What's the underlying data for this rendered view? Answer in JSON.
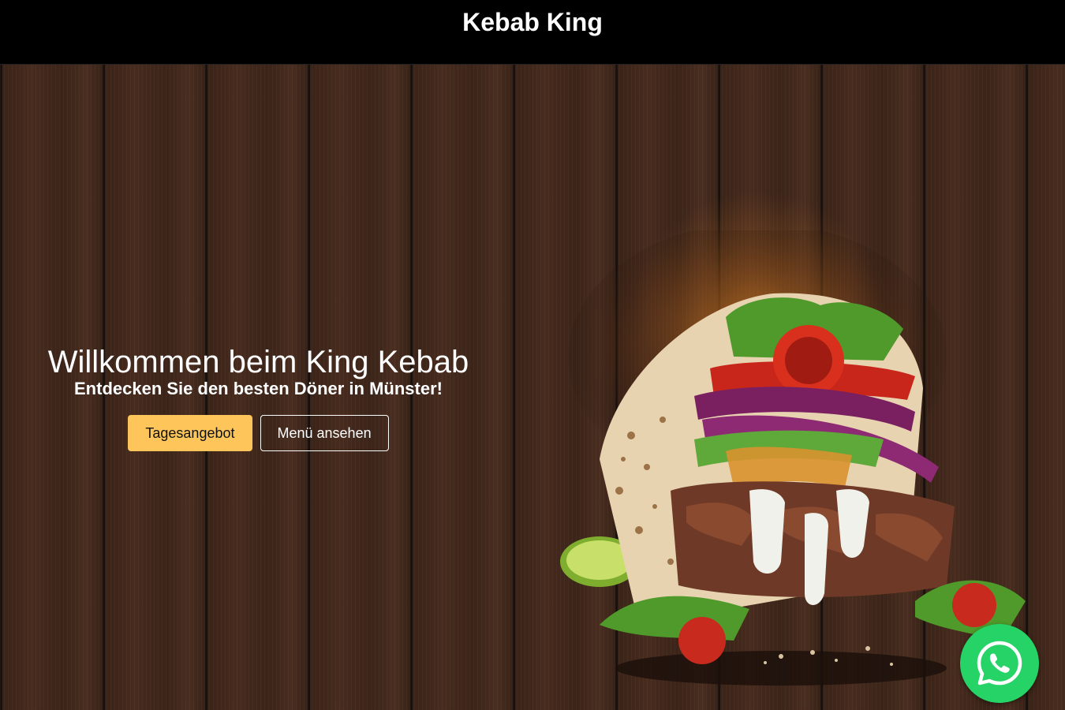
{
  "header": {
    "brand": "Kebab King"
  },
  "hero": {
    "title": "Willkommen beim King Kebab",
    "subtitle": "Entdecken Sie den besten Döner in Münster!",
    "buttons": {
      "primary": "Tagesangebot",
      "secondary": "Menü ansehen"
    },
    "image": "doner-kebab-wrap-illustration"
  },
  "floating": {
    "icon": "whatsapp-icon",
    "color": "#25d366"
  },
  "colors": {
    "accent": "#fdc55a",
    "header_bg": "#000000"
  }
}
